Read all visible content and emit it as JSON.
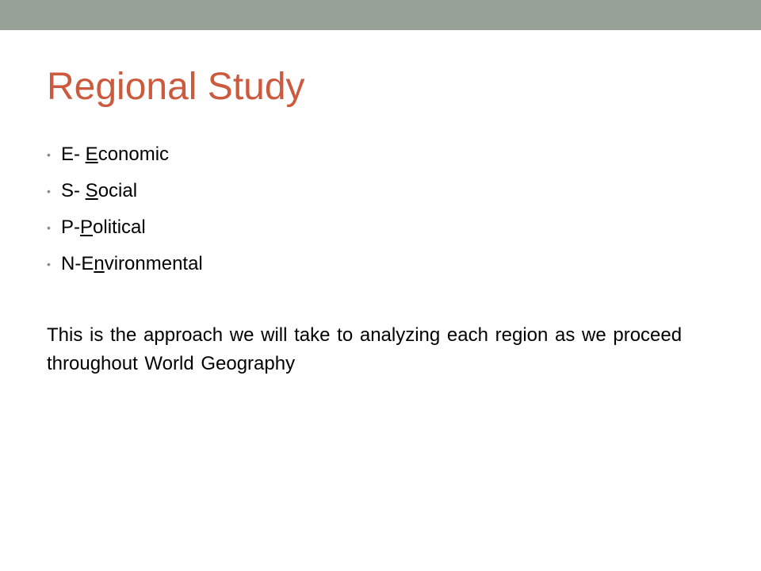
{
  "slide": {
    "title": "Regional Study",
    "colors": {
      "top_bar": "#96a198",
      "title": "#cc5a3e",
      "bullet": "#8a8a8a",
      "text": "#000000"
    },
    "bullets": [
      {
        "prefix": "E- ",
        "underlined": "E",
        "suffix": "conomic"
      },
      {
        "prefix": "S- ",
        "underlined": "S",
        "suffix": "ocial"
      },
      {
        "prefix": "P-",
        "underlined": "P",
        "suffix": "olitical"
      },
      {
        "prefix": "N-E",
        "underlined": "n",
        "suffix": "vironmental"
      }
    ],
    "paragraph": "This is the approach we will take to analyzing each region as we proceed throughout World Geography"
  }
}
